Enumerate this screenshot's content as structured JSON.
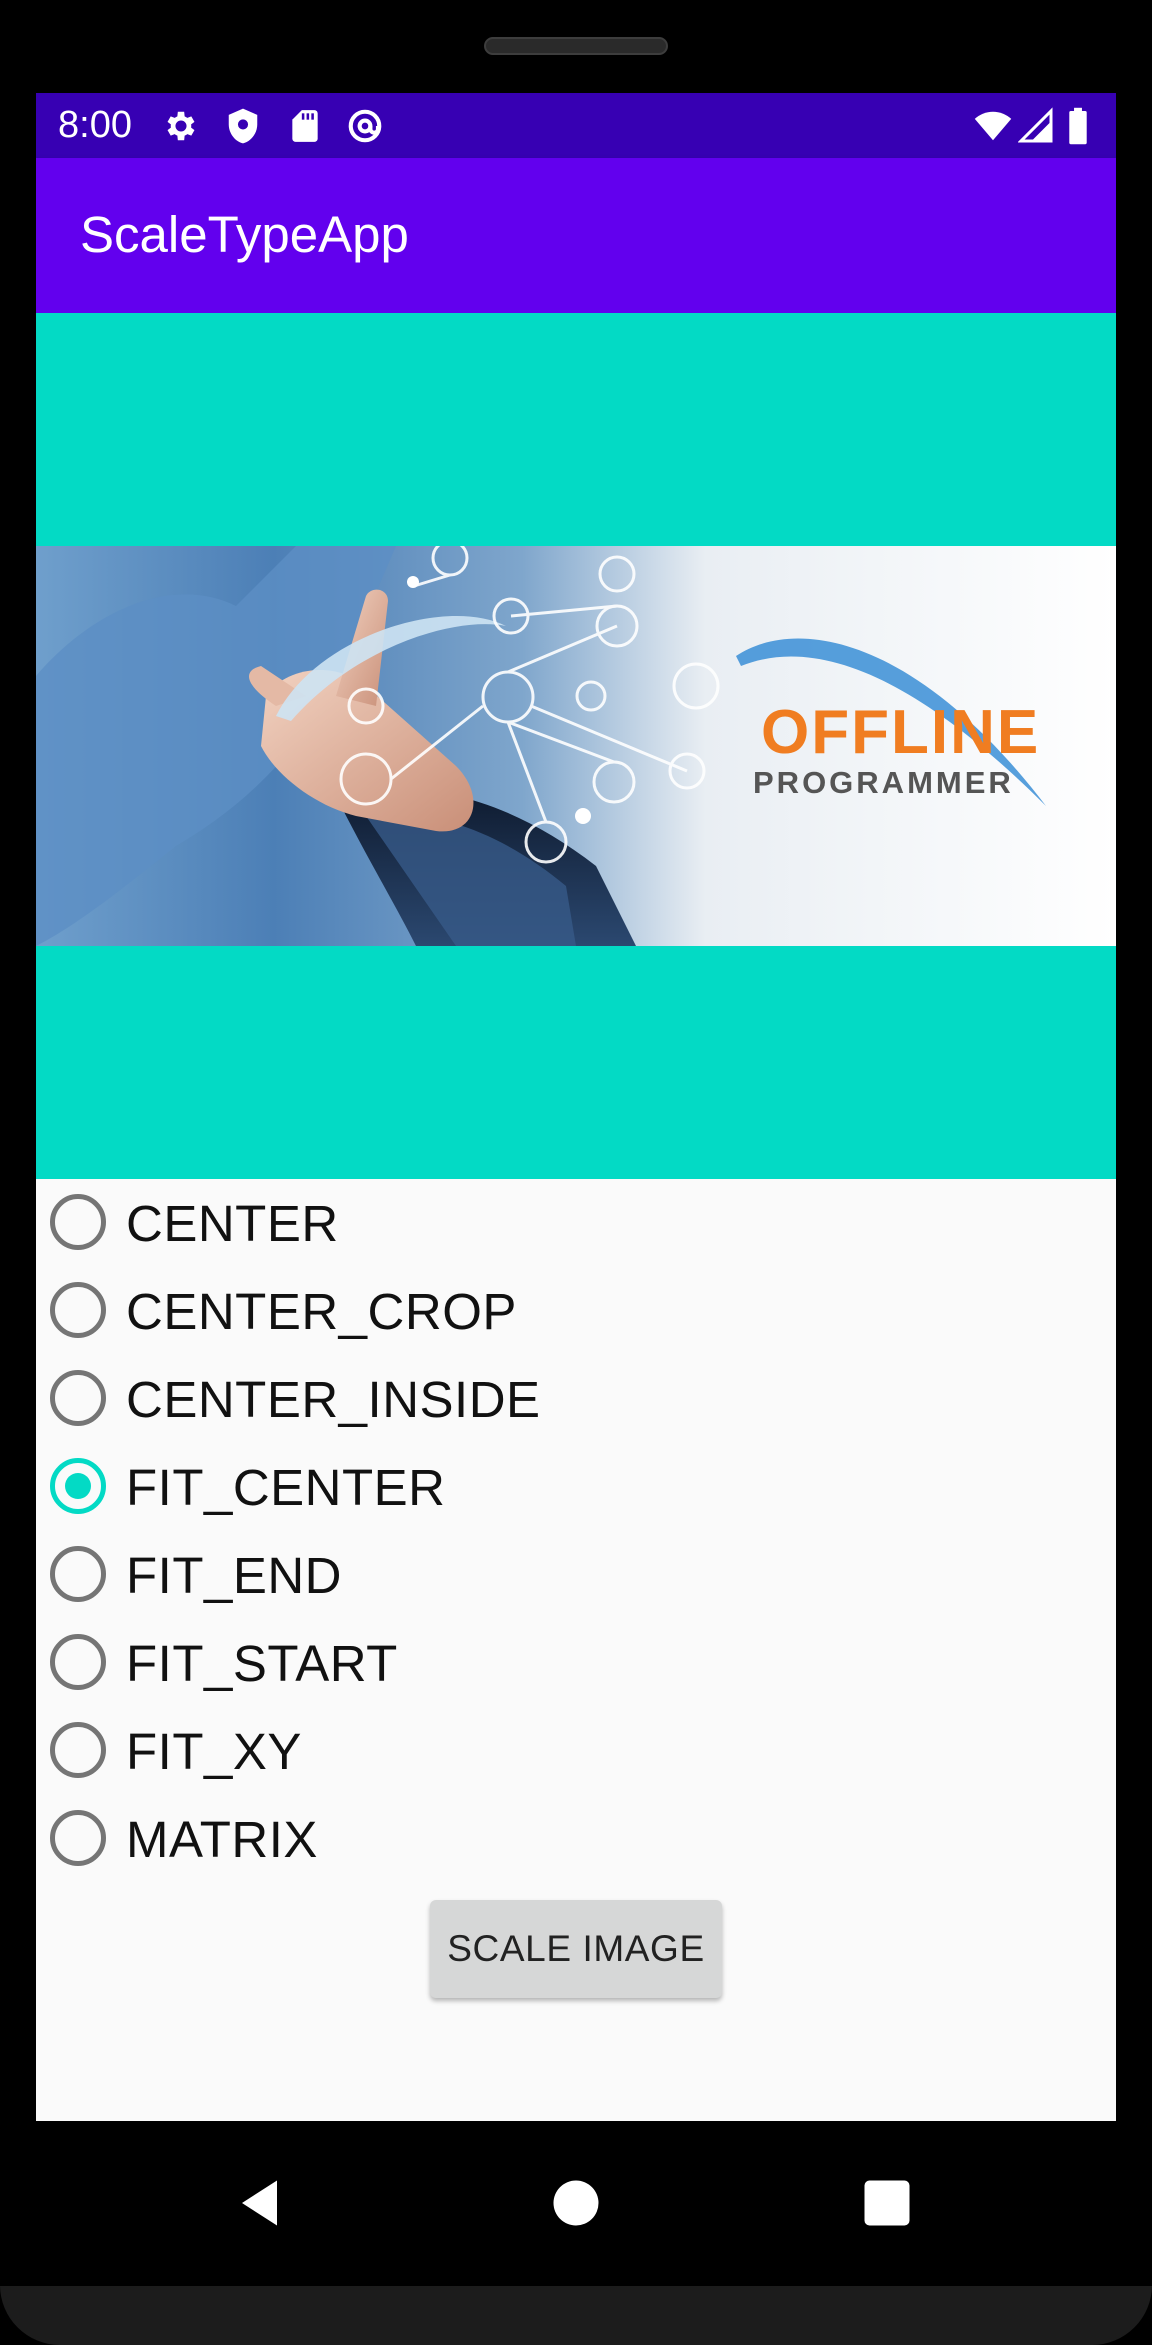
{
  "status_bar": {
    "time": "8:00",
    "left_icons": [
      "settings-icon",
      "shield-icon",
      "sd-card-icon",
      "at-sign-icon"
    ],
    "right_icons": [
      "wifi-icon",
      "cell-signal-icon",
      "battery-icon"
    ],
    "background_color": "#3700b3"
  },
  "app_bar": {
    "title": "ScaleTypeApp",
    "background_color": "#6200ee"
  },
  "image_view": {
    "background_color": "#03dac5",
    "banner": {
      "logo_line1": "OFFLINE",
      "logo_line2": "PROGRAMMER"
    }
  },
  "scale_options": {
    "selected": "FIT_CENTER",
    "items": [
      {
        "label": "CENTER",
        "checked": false
      },
      {
        "label": "CENTER_CROP",
        "checked": false
      },
      {
        "label": "CENTER_INSIDE",
        "checked": false
      },
      {
        "label": "FIT_CENTER",
        "checked": true
      },
      {
        "label": "FIT_END",
        "checked": false
      },
      {
        "label": "FIT_START",
        "checked": false
      },
      {
        "label": "FIT_XY",
        "checked": false
      },
      {
        "label": "MATRIX",
        "checked": false
      }
    ],
    "accent_color": "#03dac5"
  },
  "action": {
    "button_label": "SCALE IMAGE"
  },
  "navigation_bar": {
    "buttons": [
      "back-icon",
      "home-icon",
      "recents-icon"
    ]
  }
}
